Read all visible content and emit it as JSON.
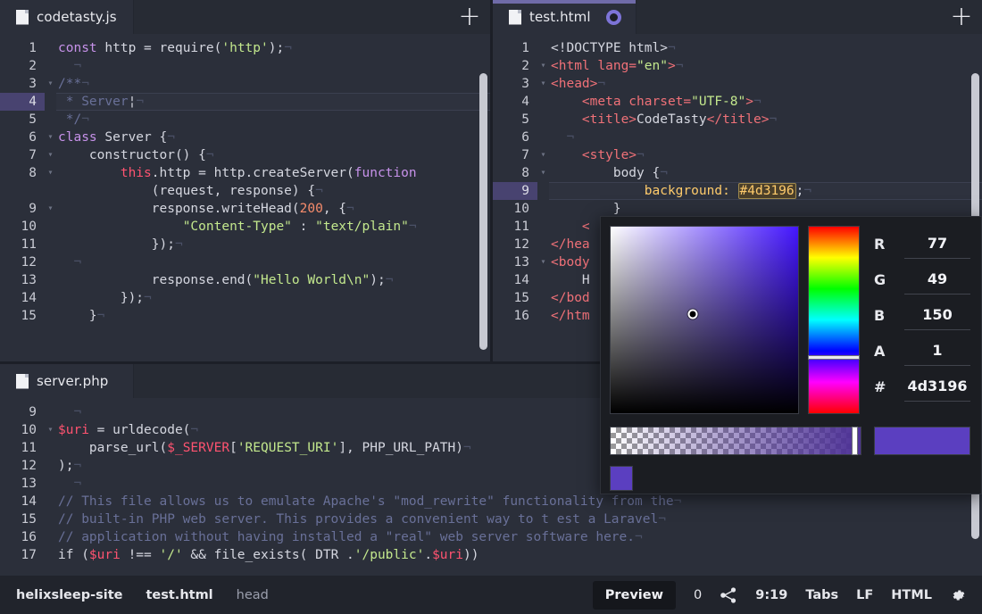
{
  "panes": {
    "left_top": {
      "tab": {
        "title": "codetasty.js",
        "icon": "file-icon",
        "active": false,
        "dirty": false
      },
      "new_tab_label": "+",
      "highlight_line": 4,
      "lines": [
        {
          "n": "1",
          "fold": "",
          "tokens": [
            {
              "t": "const",
              "c": "k"
            },
            {
              "t": " ",
              "c": "ws"
            },
            {
              "t": "http",
              "c": "plain"
            },
            {
              "t": " ",
              "c": "ws"
            },
            {
              "t": "=",
              "c": "plain"
            },
            {
              "t": " ",
              "c": "ws"
            },
            {
              "t": "require(",
              "c": "plain"
            },
            {
              "t": "'http'",
              "c": "str"
            },
            {
              "t": ");",
              "c": "plain"
            },
            {
              "t": "¬",
              "c": "ws"
            }
          ]
        },
        {
          "n": "2",
          "fold": "",
          "tokens": [
            {
              "t": "  ¬",
              "c": "ws"
            }
          ]
        },
        {
          "n": "3",
          "fold": "▾",
          "tokens": [
            {
              "t": "/**",
              "c": "com"
            },
            {
              "t": "¬",
              "c": "ws"
            }
          ]
        },
        {
          "n": "4",
          "fold": "",
          "tokens": [
            {
              "t": " * Server",
              "c": "com"
            },
            {
              "t": "¦",
              "c": "plain"
            },
            {
              "t": "¬",
              "c": "ws"
            }
          ]
        },
        {
          "n": "5",
          "fold": "",
          "tokens": [
            {
              "t": " */",
              "c": "com"
            },
            {
              "t": "¬",
              "c": "ws"
            }
          ]
        },
        {
          "n": "6",
          "fold": "▾",
          "tokens": [
            {
              "t": "class",
              "c": "k"
            },
            {
              "t": " ",
              "c": "ws"
            },
            {
              "t": "Server",
              "c": "plain"
            },
            {
              "t": " {",
              "c": "plain"
            },
            {
              "t": "¬",
              "c": "ws"
            }
          ]
        },
        {
          "n": "7",
          "fold": "▾",
          "tokens": [
            {
              "t": "    ",
              "c": "indent-guide"
            },
            {
              "t": "constructor() {",
              "c": "plain"
            },
            {
              "t": "¬",
              "c": "ws"
            }
          ]
        },
        {
          "n": "8",
          "fold": "▾",
          "tokens": [
            {
              "t": "        ",
              "c": "indent-guide"
            },
            {
              "t": "this",
              "c": "this"
            },
            {
              "t": ".http = http.createServer(",
              "c": "plain"
            },
            {
              "t": "function",
              "c": "k"
            }
          ]
        },
        {
          "n": "",
          "fold": "",
          "tokens": [
            {
              "t": "            (request, response) {",
              "c": "plain"
            },
            {
              "t": "¬",
              "c": "ws"
            }
          ]
        },
        {
          "n": "9",
          "fold": "▾",
          "tokens": [
            {
              "t": "            ",
              "c": "indent-guide"
            },
            {
              "t": "response.writeHead(",
              "c": "plain"
            },
            {
              "t": "200",
              "c": "num"
            },
            {
              "t": ", {",
              "c": "plain"
            },
            {
              "t": "¬",
              "c": "ws"
            }
          ]
        },
        {
          "n": "10",
          "fold": "",
          "tokens": [
            {
              "t": "                ",
              "c": "indent-guide"
            },
            {
              "t": "\"Content-Type\"",
              "c": "str"
            },
            {
              "t": " : ",
              "c": "plain"
            },
            {
              "t": "\"text/plain\"",
              "c": "str"
            },
            {
              "t": "¬",
              "c": "ws"
            }
          ]
        },
        {
          "n": "11",
          "fold": "",
          "tokens": [
            {
              "t": "            ",
              "c": "indent-guide"
            },
            {
              "t": "});",
              "c": "plain"
            },
            {
              "t": "¬",
              "c": "ws"
            }
          ]
        },
        {
          "n": "12",
          "fold": "",
          "tokens": [
            {
              "t": "  ¬",
              "c": "ws"
            }
          ]
        },
        {
          "n": "13",
          "fold": "",
          "tokens": [
            {
              "t": "            ",
              "c": "indent-guide"
            },
            {
              "t": "response.end(",
              "c": "plain"
            },
            {
              "t": "\"Hello World\\n\"",
              "c": "str"
            },
            {
              "t": ");",
              "c": "plain"
            },
            {
              "t": "¬",
              "c": "ws"
            }
          ]
        },
        {
          "n": "14",
          "fold": "",
          "tokens": [
            {
              "t": "        ",
              "c": "indent-guide"
            },
            {
              "t": "});",
              "c": "plain"
            },
            {
              "t": "¬",
              "c": "ws"
            }
          ]
        },
        {
          "n": "15",
          "fold": "",
          "tokens": [
            {
              "t": "    ",
              "c": "indent-guide"
            },
            {
              "t": "}",
              "c": "plain"
            },
            {
              "t": "¬",
              "c": "ws"
            }
          ]
        }
      ]
    },
    "right_top": {
      "tab": {
        "title": "test.html",
        "icon": "file-icon",
        "active": true,
        "dirty": true
      },
      "new_tab_label": "+",
      "highlight_line": 9,
      "lines": [
        {
          "n": "1",
          "fold": "",
          "tokens": [
            {
              "t": "<!DOCTYPE html>",
              "c": "plain"
            },
            {
              "t": "¬",
              "c": "ws"
            }
          ]
        },
        {
          "n": "2",
          "fold": "▾",
          "tokens": [
            {
              "t": "<html ",
              "c": "tag"
            },
            {
              "t": "lang=",
              "c": "tag"
            },
            {
              "t": "\"en\"",
              "c": "str"
            },
            {
              "t": ">",
              "c": "tag"
            },
            {
              "t": "¬",
              "c": "ws"
            }
          ]
        },
        {
          "n": "3",
          "fold": "▾",
          "tokens": [
            {
              "t": "<head>",
              "c": "tag"
            },
            {
              "t": "¬",
              "c": "ws"
            }
          ]
        },
        {
          "n": "4",
          "fold": "",
          "tokens": [
            {
              "t": "    ",
              "c": "indent-guide"
            },
            {
              "t": "<meta charset=",
              "c": "tag"
            },
            {
              "t": "\"UTF-8\"",
              "c": "str"
            },
            {
              "t": ">",
              "c": "tag"
            },
            {
              "t": "¬",
              "c": "ws"
            }
          ]
        },
        {
          "n": "5",
          "fold": "",
          "tokens": [
            {
              "t": "    ",
              "c": "indent-guide"
            },
            {
              "t": "<title>",
              "c": "tag"
            },
            {
              "t": "CodeTasty",
              "c": "plain"
            },
            {
              "t": "</title>",
              "c": "tag"
            },
            {
              "t": "¬",
              "c": "ws"
            }
          ]
        },
        {
          "n": "6",
          "fold": "",
          "tokens": [
            {
              "t": "  ¬",
              "c": "ws"
            }
          ]
        },
        {
          "n": "7",
          "fold": "▾",
          "tokens": [
            {
              "t": "    ",
              "c": "indent-guide"
            },
            {
              "t": "<style>",
              "c": "tag"
            },
            {
              "t": "¬",
              "c": "ws"
            }
          ]
        },
        {
          "n": "8",
          "fold": "▾",
          "tokens": [
            {
              "t": "        ",
              "c": "indent-guide"
            },
            {
              "t": "body",
              "c": "plain"
            },
            {
              "t": " {",
              "c": "plain"
            },
            {
              "t": "¬",
              "c": "ws"
            }
          ]
        },
        {
          "n": "9",
          "fold": "",
          "tokens": [
            {
              "t": "            ",
              "c": "indent-guide"
            },
            {
              "t": "background:",
              "c": "prop"
            },
            {
              "t": " ",
              "c": "ws"
            },
            {
              "t": "#4d3196",
              "c": "colchip"
            },
            {
              "t": ";",
              "c": "plain"
            },
            {
              "t": "¬",
              "c": "ws"
            }
          ]
        },
        {
          "n": "10",
          "fold": "",
          "tokens": [
            {
              "t": "        ",
              "c": "indent-guide"
            },
            {
              "t": "}",
              "c": "plain"
            }
          ]
        },
        {
          "n": "11",
          "fold": "",
          "tokens": [
            {
              "t": "    ",
              "c": "indent-guide"
            },
            {
              "t": "<",
              "c": "tag"
            }
          ]
        },
        {
          "n": "12",
          "fold": "",
          "tokens": [
            {
              "t": "</hea",
              "c": "tag"
            }
          ]
        },
        {
          "n": "13",
          "fold": "▾",
          "tokens": [
            {
              "t": "<body",
              "c": "tag"
            }
          ]
        },
        {
          "n": "14",
          "fold": "",
          "tokens": [
            {
              "t": "    ",
              "c": "indent-guide"
            },
            {
              "t": "H",
              "c": "plain"
            }
          ]
        },
        {
          "n": "15",
          "fold": "",
          "tokens": [
            {
              "t": "</bod",
              "c": "tag"
            }
          ]
        },
        {
          "n": "16",
          "fold": "",
          "tokens": [
            {
              "t": "</htm",
              "c": "tag"
            }
          ]
        }
      ]
    },
    "bottom": {
      "tab": {
        "title": "server.php",
        "icon": "file-icon",
        "active": false,
        "dirty": false
      },
      "lines": [
        {
          "n": "9",
          "fold": "",
          "tokens": [
            {
              "t": "  ¬",
              "c": "ws"
            }
          ]
        },
        {
          "n": "10",
          "fold": "▾",
          "tokens": [
            {
              "t": "$uri",
              "c": "var"
            },
            {
              "t": " = urldecode(",
              "c": "plain"
            },
            {
              "t": "¬",
              "c": "ws"
            }
          ]
        },
        {
          "n": "11",
          "fold": "",
          "tokens": [
            {
              "t": "    ",
              "c": "indent-guide"
            },
            {
              "t": "parse_url(",
              "c": "plain"
            },
            {
              "t": "$_SERVER",
              "c": "var"
            },
            {
              "t": "[",
              "c": "plain"
            },
            {
              "t": "'REQUEST_URI'",
              "c": "str"
            },
            {
              "t": "], PHP_URL_PATH)",
              "c": "plain"
            },
            {
              "t": "¬",
              "c": "ws"
            }
          ]
        },
        {
          "n": "12",
          "fold": "",
          "tokens": [
            {
              "t": ");",
              "c": "plain"
            },
            {
              "t": "¬",
              "c": "ws"
            }
          ]
        },
        {
          "n": "13",
          "fold": "",
          "tokens": [
            {
              "t": "  ¬",
              "c": "ws"
            }
          ]
        },
        {
          "n": "14",
          "fold": "",
          "tokens": [
            {
              "t": "// This file allows us to emulate Apache's \"mod_rewrite\" functionality from the",
              "c": "com"
            },
            {
              "t": "¬",
              "c": "ws"
            }
          ]
        },
        {
          "n": "15",
          "fold": "",
          "tokens": [
            {
              "t": "// built-in PHP web server. This provides a convenient way to t est a Laravel",
              "c": "com"
            },
            {
              "t": "¬",
              "c": "ws"
            }
          ]
        },
        {
          "n": "16",
          "fold": "",
          "tokens": [
            {
              "t": "// application without having installed a \"real\" web server software here.",
              "c": "com"
            },
            {
              "t": "¬",
              "c": "ws"
            }
          ]
        },
        {
          "n": "17",
          "fold": "",
          "tokens": [
            {
              "t": "if (",
              "c": "plain"
            },
            {
              "t": "$uri",
              "c": "var"
            },
            {
              "t": " !== ",
              "c": "plain"
            },
            {
              "t": "'/'",
              "c": "str"
            },
            {
              "t": " && file_exists( DTR .",
              "c": "plain"
            },
            {
              "t": "'/public'",
              "c": "str"
            },
            {
              "t": ".",
              "c": "plain"
            },
            {
              "t": "$uri",
              "c": "var"
            },
            {
              "t": "))",
              "c": "plain"
            }
          ]
        }
      ]
    }
  },
  "color_picker": {
    "hex_label": "#",
    "fields": [
      {
        "label": "R",
        "value": "77"
      },
      {
        "label": "G",
        "value": "49"
      },
      {
        "label": "B",
        "value": "150"
      },
      {
        "label": "A",
        "value": "1"
      }
    ],
    "hex_field": {
      "label": "#",
      "value": "4d3196"
    },
    "selected_color": "#4d3196",
    "preview_color": "#5b3fc0",
    "recent_swatches": [
      "#5b3fc0"
    ]
  },
  "statusbar": {
    "left": [
      {
        "name": "project",
        "text": "helixsleep-site",
        "bold": true
      },
      {
        "name": "file",
        "text": "test.html",
        "bold": true
      },
      {
        "name": "scope",
        "text": "head",
        "bold": false
      }
    ],
    "preview_label": "Preview",
    "collab_count": "0",
    "share_icon": "share-icon",
    "cursor_position": "9:19",
    "indent_mode": "Tabs",
    "line_ending": "LF",
    "language": "HTML",
    "settings_icon": "gear-icon"
  }
}
